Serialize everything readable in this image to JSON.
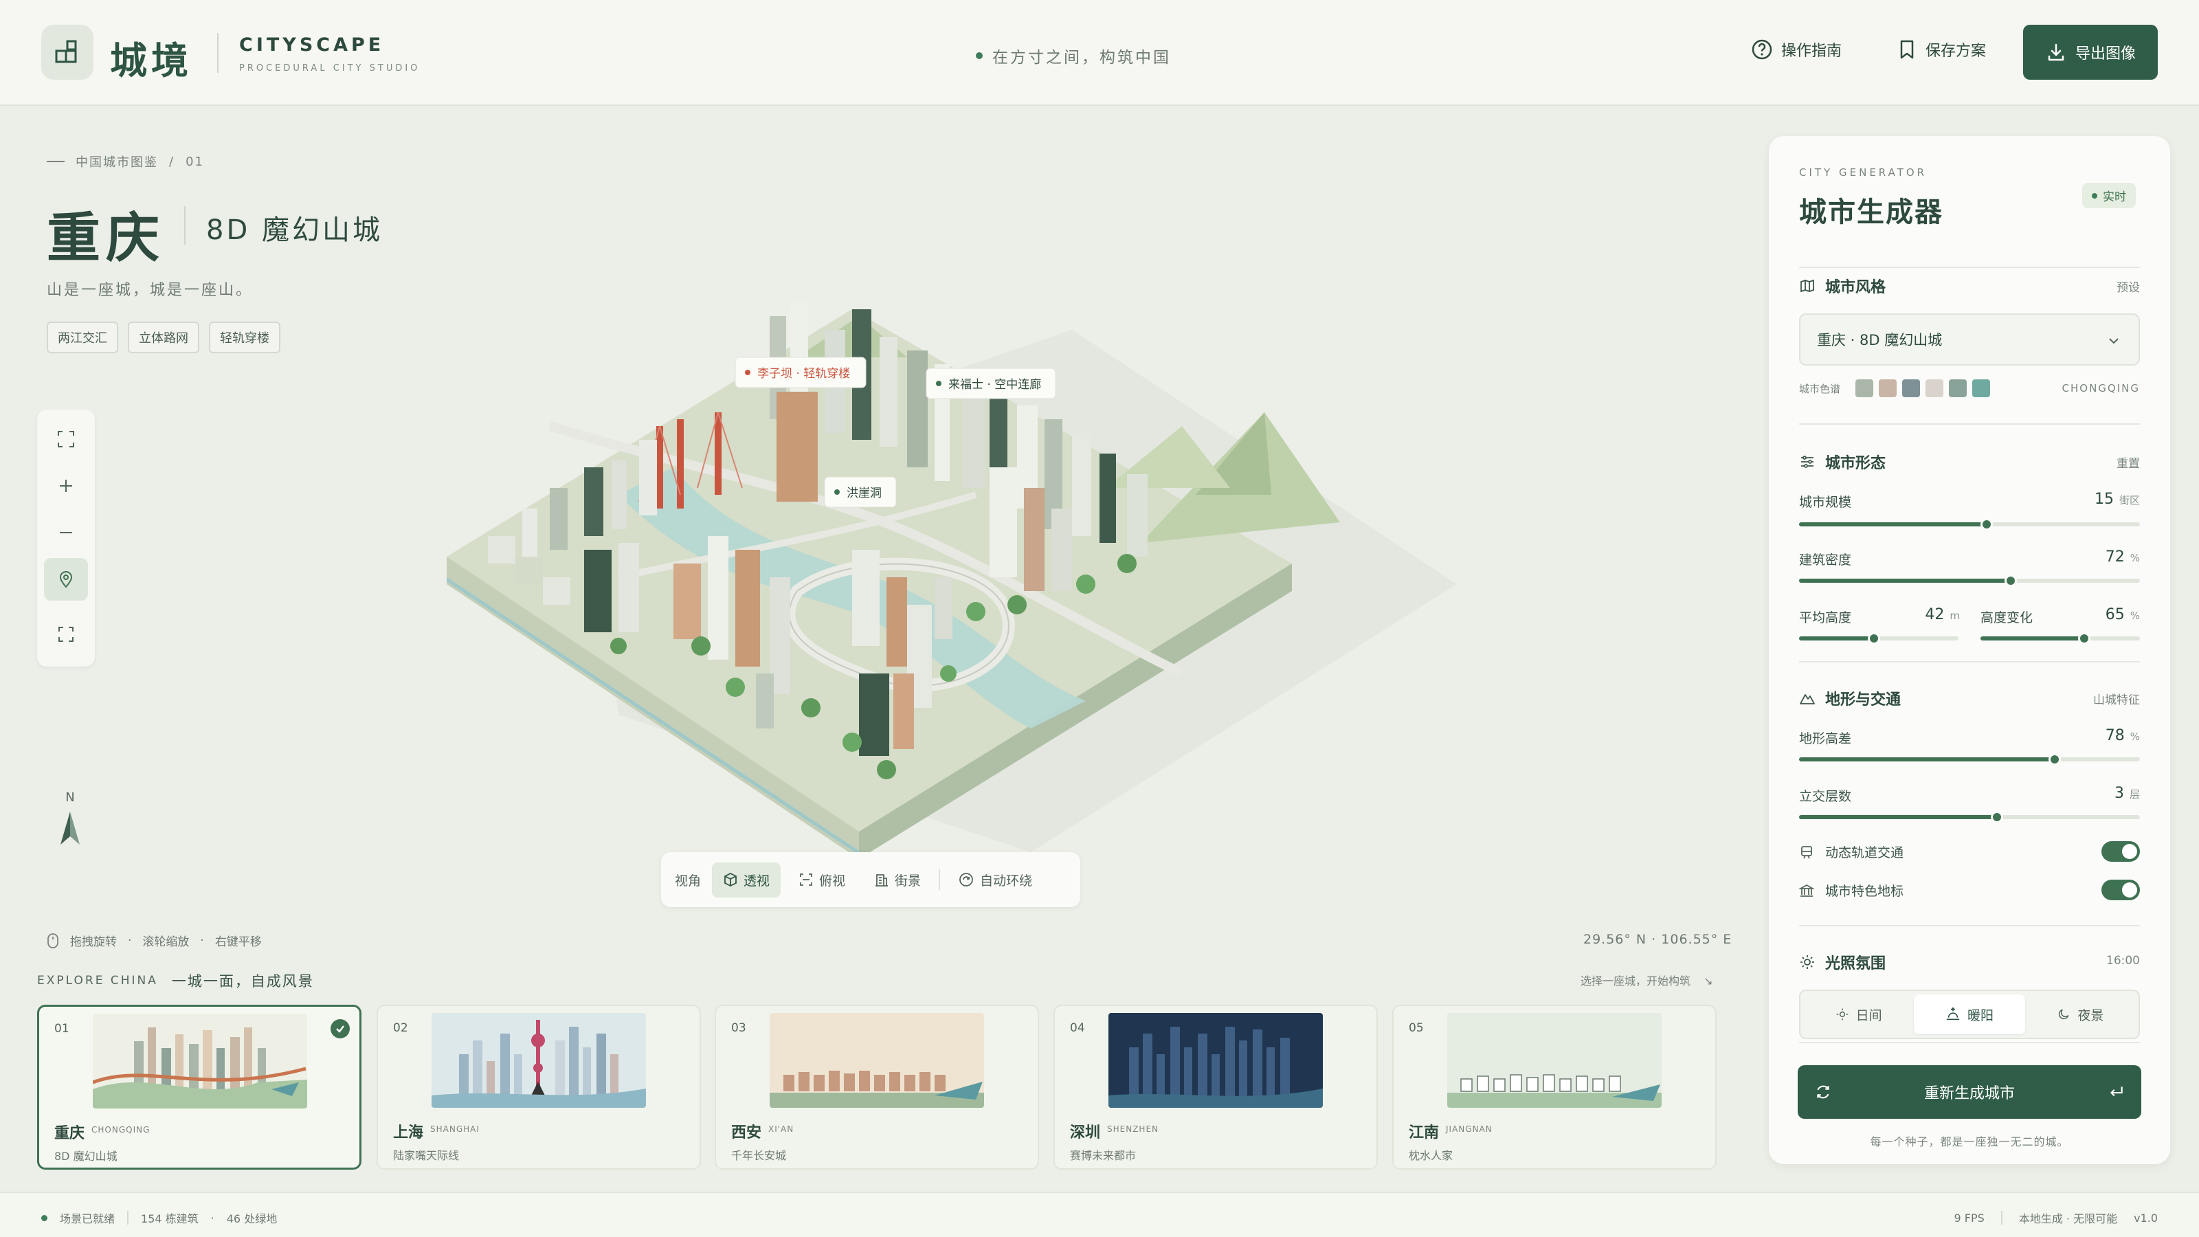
{
  "header": {
    "brand_cn": "城境",
    "brand_en": "CITYSCAPE",
    "brand_sub": "PROCEDURAL CITY STUDIO",
    "tagline": "在方寸之间，构筑中国",
    "guide_label": "操作指南",
    "save_label": "保存方案",
    "export_label": "导出图像"
  },
  "hero": {
    "breadcrumb": "中国城市图鉴",
    "breadcrumb_sep": "/",
    "breadcrumb_index": "01",
    "city_name": "重庆",
    "city_subtitle": "8D 魔幻山城",
    "description": "山是一座城，城是一座山。",
    "tags": [
      "两江交汇",
      "立体路网",
      "轻轨穿楼"
    ]
  },
  "scene": {
    "labels": [
      "李子坝 · 轻轨穿楼",
      "来福士 · 空中连廊",
      "洪崖洞"
    ],
    "compass_label": "N",
    "hints": [
      "拖拽旋转",
      "滚轮缩放",
      "右键平移"
    ],
    "coordinates": "29.56° N · 106.55° E"
  },
  "view_bar": {
    "label": "视角",
    "options": [
      "透视",
      "俯视",
      "街景"
    ],
    "active_index": 0,
    "auto_orbit": "自动环绕"
  },
  "explore": {
    "kicker": "EXPLORE CHINA",
    "title": "一城一面，自成风景",
    "hint": "选择一座城，开始构筑",
    "cards": [
      {
        "num": "01",
        "name": "重庆",
        "ename": "CHONGQING",
        "desc": "8D 魔幻山城",
        "active": true,
        "sky": "#eef0e6",
        "ground": "#a9c7a3"
      },
      {
        "num": "02",
        "name": "上海",
        "ename": "SHANGHAI",
        "desc": "陆家嘴天际线",
        "active": false,
        "sky": "#dde8ea",
        "ground": "#8fb8c6"
      },
      {
        "num": "03",
        "name": "西安",
        "ename": "XI'AN",
        "desc": "千年长安城",
        "active": false,
        "sky": "#efe4d2",
        "ground": "#9fb99a"
      },
      {
        "num": "04",
        "name": "深圳",
        "ename": "SHENZHEN",
        "desc": "赛博未来都市",
        "active": false,
        "sky": "#1f3550",
        "ground": "#3d6c86"
      },
      {
        "num": "05",
        "name": "江南",
        "ename": "JIANGNAN",
        "desc": "枕水人家",
        "active": false,
        "sky": "#e5ece2",
        "ground": "#a7c5a5"
      }
    ]
  },
  "footer": {
    "status": "场景已就绪",
    "buildings": "154 栋建筑",
    "greens": "46 处绿地",
    "fps": "9 FPS",
    "mode": "本地生成 · 无限可能",
    "version": "v1.0"
  },
  "panel": {
    "kicker": "CITY GENERATOR",
    "title": "城市生成器",
    "badge": "实时",
    "style": {
      "title": "城市风格",
      "aside": "预设",
      "selected": "重庆 · 8D 魔幻山城",
      "palette_label": "城市色谱",
      "palette": [
        "#a9b6a8",
        "#c8b5a6",
        "#7e9196",
        "#d9d3cb",
        "#8aa39a",
        "#6fa9a0"
      ],
      "palette_code": "CHONGQING"
    },
    "form": {
      "title": "城市形态",
      "aside": "重置",
      "scale": {
        "label": "城市规模",
        "value": "15",
        "unit": "街区",
        "pct": 0.55
      },
      "density": {
        "label": "建筑密度",
        "value": "72",
        "unit": "%",
        "pct": 0.62
      },
      "height": {
        "label": "平均高度",
        "value": "42",
        "unit": "m",
        "pct": 0.47
      },
      "variation": {
        "label": "高度变化",
        "value": "65",
        "unit": "%",
        "pct": 0.65
      }
    },
    "terrain": {
      "title": "地形与交通",
      "aside": "山城特征",
      "elevation": {
        "label": "地形高差",
        "value": "78",
        "unit": "%",
        "pct": 0.75
      },
      "layers": {
        "label": "立交层数",
        "value": "3",
        "unit": "层",
        "pct": 0.58
      },
      "toggle_rail": "动态轨道交通",
      "toggle_landmark": "城市特色地标"
    },
    "lighting": {
      "title": "光照氛围",
      "time": "16:00",
      "options": [
        "日间",
        "暖阳",
        "夜景"
      ],
      "active_index": 1
    },
    "regen_label": "重新生成城市",
    "regen_note": "每一个种子，都是一座独一无二的城。"
  }
}
